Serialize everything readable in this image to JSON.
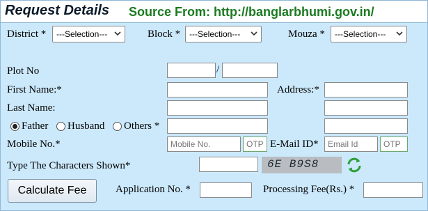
{
  "header": {
    "title": "Request Details",
    "source": "Source From: http://banglarbhumi.gov.in/"
  },
  "location": {
    "district_label": "District *",
    "district_value": "---Selection---",
    "block_label": "Block *",
    "block_value": "---Selection---",
    "mouza_label": "Mouza *",
    "mouza_value": "---Selection---"
  },
  "plot": {
    "label": "Plot No",
    "separator": "/"
  },
  "name": {
    "first_label": "First Name:*",
    "last_label": "Last Name:",
    "address_label": "Address:*"
  },
  "relation": {
    "options": [
      "Father",
      "Husband",
      "Others *"
    ],
    "selected": "Father"
  },
  "contact": {
    "mobile_label": "Mobile No.*",
    "mobile_placeholder": "Mobile No.",
    "otp_placeholder": "OTP",
    "email_label": "E-Mail ID*",
    "email_placeholder": "Email Id"
  },
  "captcha": {
    "label": "Type The Characters Shown*",
    "text": "6E B9S8"
  },
  "actions": {
    "calculate_label": "Calculate Fee",
    "application_label": "Application No. *",
    "fee_label": "Processing Fee(Rs.) *"
  }
}
